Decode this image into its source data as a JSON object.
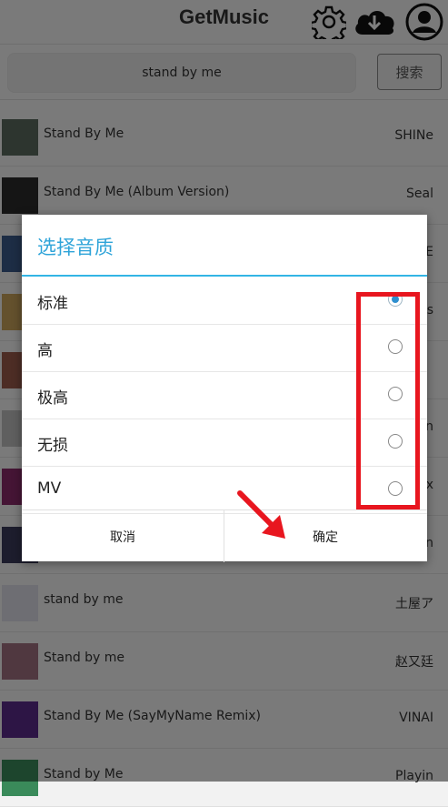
{
  "app": {
    "title": "GetMusic",
    "icons": {
      "settings": "gear-icon",
      "download": "cloud-download-icon",
      "account": "account-icon"
    }
  },
  "search": {
    "query": "stand by me",
    "button_label": "搜索"
  },
  "results": [
    {
      "song": "Stand By Me",
      "artist": "SHINe",
      "thumb_color": "#5a6a5f"
    },
    {
      "song": "Stand By Me (Album Version)",
      "artist": "Seal",
      "thumb_color": "#2a2a2a"
    },
    {
      "song": "",
      "artist": "E",
      "thumb_color": "#3a5a8a"
    },
    {
      "song": "",
      "artist": "s",
      "thumb_color": "#c9a25a"
    },
    {
      "song": "",
      "artist": "",
      "thumb_color": "#9a5a4a"
    },
    {
      "song": "",
      "artist": "n",
      "thumb_color": "#bfbfbf"
    },
    {
      "song": "",
      "artist": "x",
      "thumb_color": "#8a2a6a"
    },
    {
      "song": "",
      "artist": "n",
      "thumb_color": "#3a3a5a"
    },
    {
      "song": "stand by me",
      "artist": "土屋ア",
      "thumb_color": "#dcdce6"
    },
    {
      "song": "Stand by me",
      "artist": "赵又廷",
      "thumb_color": "#a07080"
    },
    {
      "song": "Stand By Me (SayMyName Remix)",
      "artist": "VINAI",
      "thumb_color": "#5a2a8a"
    },
    {
      "song": "Stand by Me",
      "artist": "Playin",
      "thumb_color": "#3a8a5a"
    }
  ],
  "dialog": {
    "title": "选择音质",
    "options": [
      {
        "label": "标准",
        "selected": true
      },
      {
        "label": "高",
        "selected": false
      },
      {
        "label": "极高",
        "selected": false
      },
      {
        "label": "无损",
        "selected": false
      },
      {
        "label": "MV",
        "selected": false
      }
    ],
    "cancel_label": "取消",
    "confirm_label": "确定"
  },
  "colors": {
    "accent": "#33b5e5",
    "highlight": "#e8161f"
  }
}
